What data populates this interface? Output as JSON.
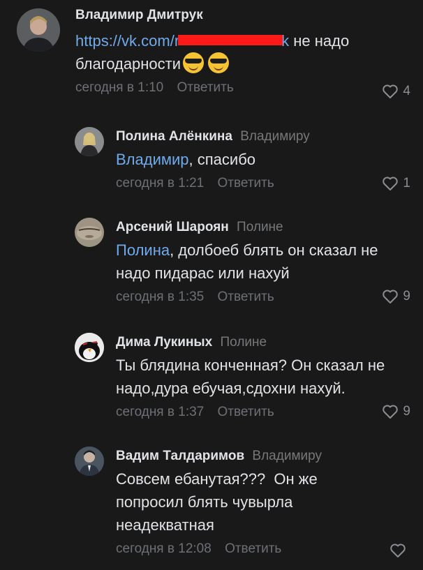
{
  "comments": [
    {
      "author": "Владимир Дмитрук",
      "reply_to": "",
      "link_start": "https://vk.com/r",
      "link_end": "k",
      "text_after_link": " не надо",
      "text_line2": "благодарности",
      "time": "сегодня в 1:10",
      "reply_label": "Ответить",
      "likes": "4"
    },
    {
      "author": "Полина Алёнкина",
      "reply_to": "Владимиру",
      "mention": "Владимир",
      "text": ", спасибо",
      "time": "сегодня в 1:21",
      "reply_label": "Ответить",
      "likes": "1"
    },
    {
      "author": "Арсений Шароян",
      "reply_to": "Полине",
      "mention": "Полина",
      "text": ", долбоеб блять он сказал не надо пидарас или нахуй",
      "time": "сегодня в 1:35",
      "reply_label": "Ответить",
      "likes": "9"
    },
    {
      "author": "Дима Лукиных",
      "reply_to": "Полине",
      "text": "Ты блядина конченная? Он сказал не надо,дура ебучая,сдохни нахуй.",
      "time": "сегодня в 1:37",
      "reply_label": "Ответить",
      "likes": "9"
    },
    {
      "author": "Вадим Талдаримов",
      "reply_to": "Владимиру",
      "text": "Совсем ебанутая???  Он же попросил блять чувырла неадекватная",
      "time": "сегодня в 12:08",
      "reply_label": "Ответить",
      "likes": ""
    }
  ],
  "colors": {
    "background": "#19191a",
    "text": "#e1e3e6",
    "link": "#71aaeb",
    "muted": "#6d7075",
    "redaction": "#ff1a1a"
  }
}
